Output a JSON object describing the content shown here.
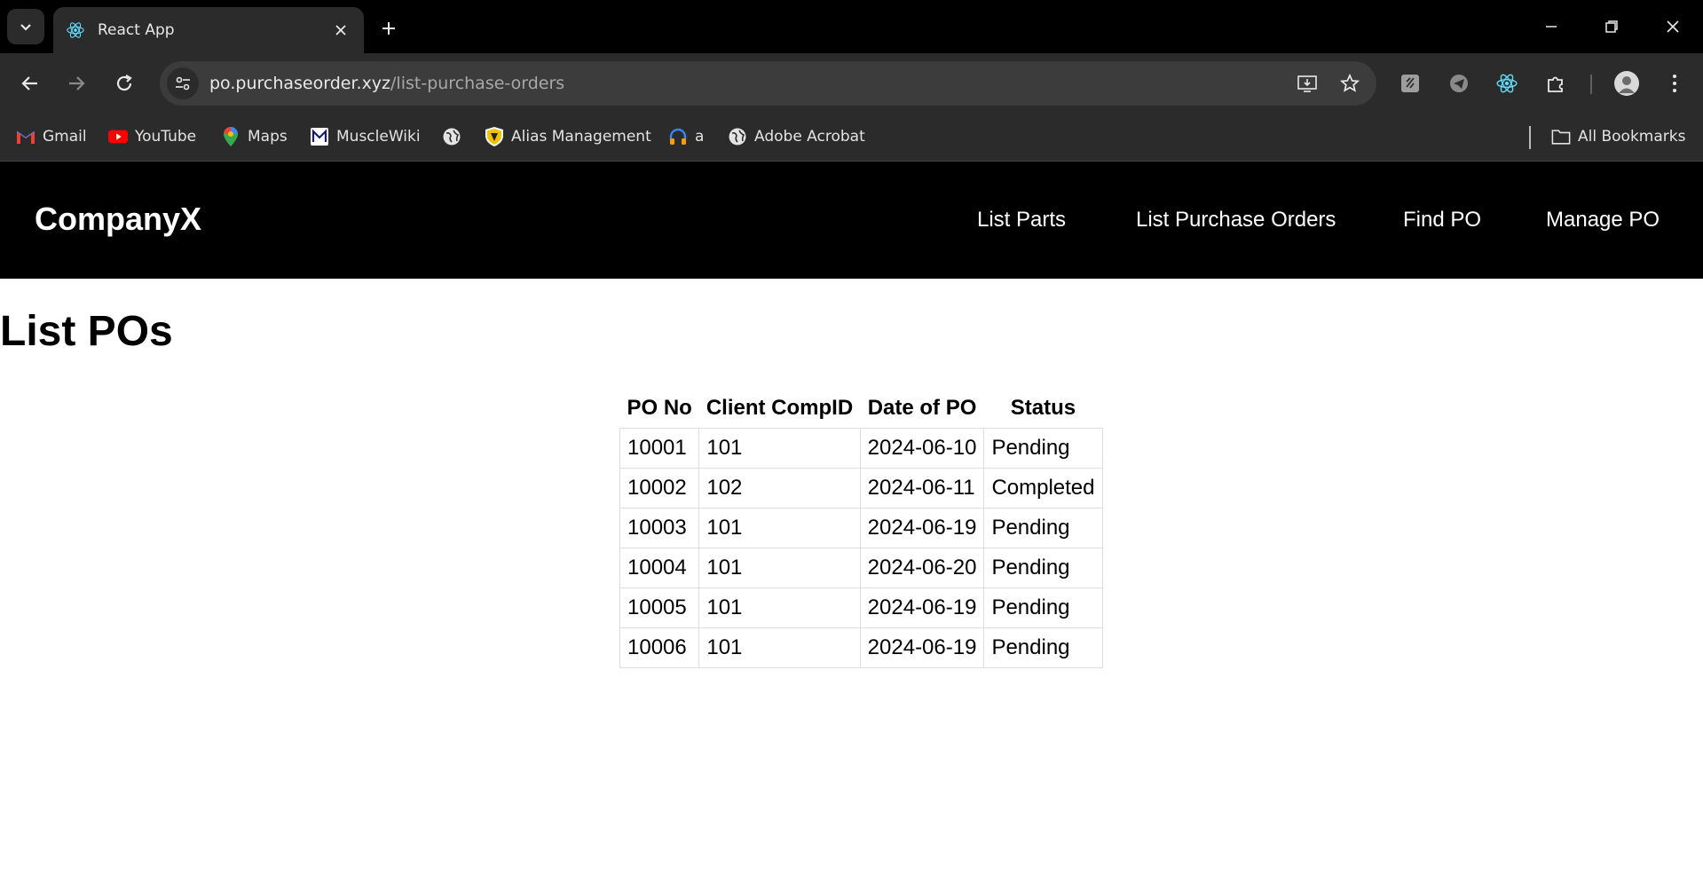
{
  "browser": {
    "tab_title": "React App",
    "url_host": "po.purchaseorder.xyz",
    "url_path": "/list-purchase-orders",
    "bookmarks": [
      {
        "label": "Gmail",
        "icon": "gmail-icon"
      },
      {
        "label": "YouTube",
        "icon": "youtube-icon"
      },
      {
        "label": "Maps",
        "icon": "maps-icon"
      },
      {
        "label": "MuscleWiki",
        "icon": "musclewiki-icon"
      },
      {
        "label": "",
        "icon": "globe-icon"
      },
      {
        "label": "Alias Management",
        "icon": "shield-icon"
      },
      {
        "label": "a",
        "icon": "headset-icon"
      },
      {
        "label": "Adobe Acrobat",
        "icon": "globe-icon"
      }
    ],
    "all_bookmarks_label": "All Bookmarks"
  },
  "app": {
    "brand": "CompanyX",
    "nav": [
      "List Parts",
      "List Purchase Orders",
      "Find PO",
      "Manage PO"
    ],
    "page_title": "List POs",
    "table": {
      "headers": [
        "PO No",
        "Client CompID",
        "Date of PO",
        "Status"
      ],
      "rows": [
        [
          "10001",
          "101",
          "2024-06-10",
          "Pending"
        ],
        [
          "10002",
          "102",
          "2024-06-11",
          "Completed"
        ],
        [
          "10003",
          "101",
          "2024-06-19",
          "Pending"
        ],
        [
          "10004",
          "101",
          "2024-06-20",
          "Pending"
        ],
        [
          "10005",
          "101",
          "2024-06-19",
          "Pending"
        ],
        [
          "10006",
          "101",
          "2024-06-19",
          "Pending"
        ]
      ]
    }
  },
  "colors": {
    "chrome_dark": "#2b2b2b",
    "tabstrip": "#000000",
    "app_nav_bg": "#000000",
    "react_blue": "#61dafb"
  }
}
